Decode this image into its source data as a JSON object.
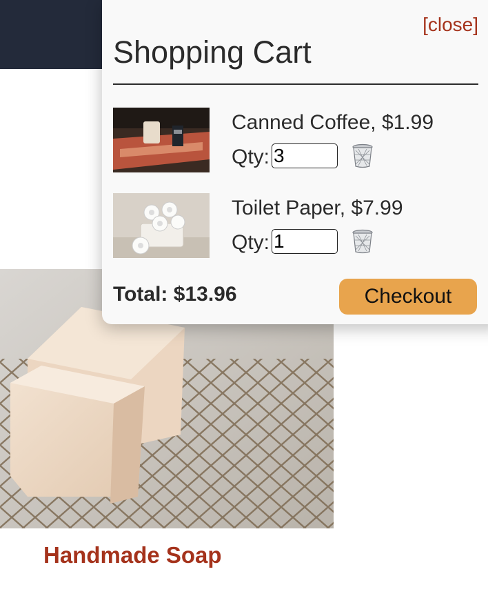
{
  "header": {},
  "product": {
    "name": "Handmade Soap"
  },
  "cart": {
    "close_label": "[close]",
    "title": "Shopping Cart",
    "items": [
      {
        "label": "Canned Coffee, $1.99",
        "qty_label": "Qty:",
        "qty": "3",
        "image": "coffee-image",
        "remove_icon": "trash-icon"
      },
      {
        "label": "Toilet Paper, $7.99",
        "qty_label": "Qty:",
        "qty": "1",
        "image": "toilet-paper-image",
        "remove_icon": "trash-icon"
      }
    ],
    "total_label": "Total: $13.96",
    "checkout_label": "Checkout"
  },
  "colors": {
    "header_bg": "#232a3a",
    "accent_red": "#a5331c",
    "checkout_bg": "#e8a44d"
  }
}
